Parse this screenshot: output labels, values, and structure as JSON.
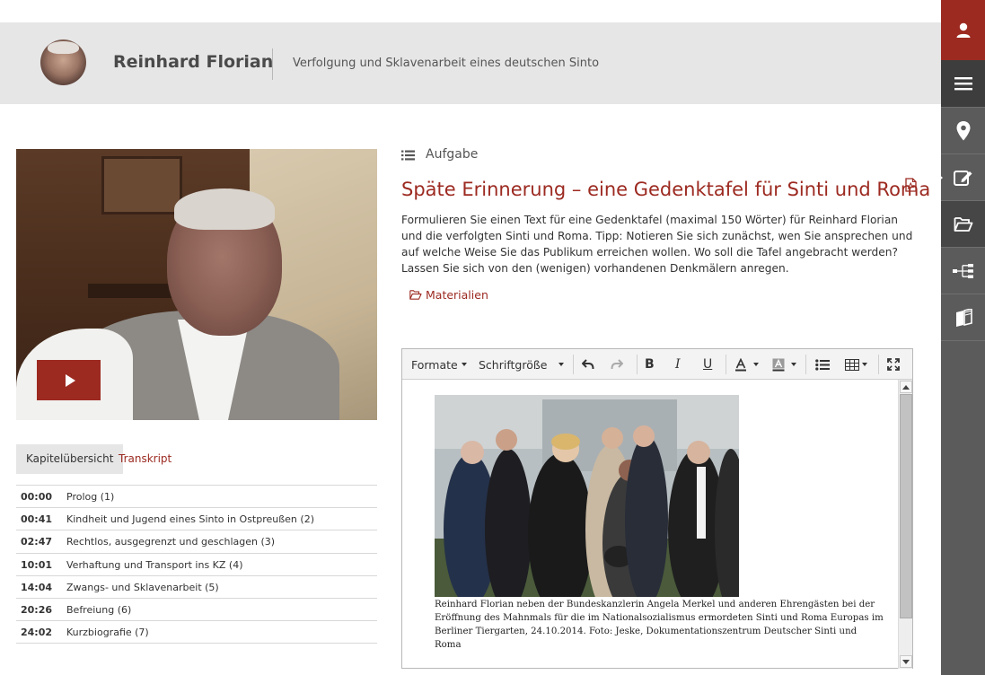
{
  "header": {
    "title": "Reinhard Florian",
    "subtitle": "Verfolgung und Sklavenarbeit eines deutschen Sinto",
    "avatar_icon": "portrait-avatar"
  },
  "sidebar": {
    "items": [
      {
        "icon": "user-icon",
        "active_color": "#9c2a21"
      },
      {
        "icon": "menu-icon"
      },
      {
        "icon": "location-pin-icon"
      },
      {
        "icon": "edit-icon",
        "selected": true
      },
      {
        "icon": "folder-open-icon"
      },
      {
        "icon": "sitemap-icon"
      },
      {
        "icon": "books-icon"
      }
    ]
  },
  "tabs": {
    "overview": "Kapitelübersicht",
    "transcript": "Transkript"
  },
  "chapters": [
    {
      "time": "00:00",
      "title": "Prolog (1)"
    },
    {
      "time": "00:41",
      "title": "Kindheit und Jugend eines Sinto in Ostpreußen (2)"
    },
    {
      "time": "02:47",
      "title": "Rechtlos, ausgegrenzt und geschlagen (3)"
    },
    {
      "time": "10:01",
      "title": "Verhaftung und Transport ins KZ (4)"
    },
    {
      "time": "14:04",
      "title": "Zwangs- und Sklavenarbeit (5)"
    },
    {
      "time": "20:26",
      "title": "Befreiung (6)"
    },
    {
      "time": "24:02",
      "title": "Kurzbiografie (7)"
    }
  ],
  "task": {
    "label": "Aufgabe",
    "title": "Späte Erinnerung – eine Gedenktafel für Sinti und Roma",
    "body": "Formulieren Sie einen Text für eine Gedenktafel (maximal 150 Wörter) für Reinhard Florian und die verfolgten Sinti und Roma. Tipp: Notieren Sie sich zunächst, wen Sie ansprechen und auf welche Weise Sie das Publikum erreichen wollen. Wo soll die Tafel angebracht werden? Lassen Sie sich von den (wenigen) vorhandenen Denkmälern anregen.",
    "materials": "Materialien"
  },
  "editor": {
    "toolbar": {
      "formats": "Formate",
      "font_size": "Schriftgröße"
    },
    "caption": "Reinhard Florian neben der Bundeskanzlerin Angela Merkel und anderen Ehrengästen bei der Eröffnung des Mahnmals für die im Nationalsozialismus ermordeten Sinti und Roma Europas im Berliner Tiergarten, 24.10.2014. Foto: Jeske, Dokumentationszentrum Deutscher Sinti und Roma"
  },
  "colors": {
    "accent": "#9c2a21",
    "sidebar": "#5b5b5b",
    "header_bg": "#e6e6e6"
  }
}
